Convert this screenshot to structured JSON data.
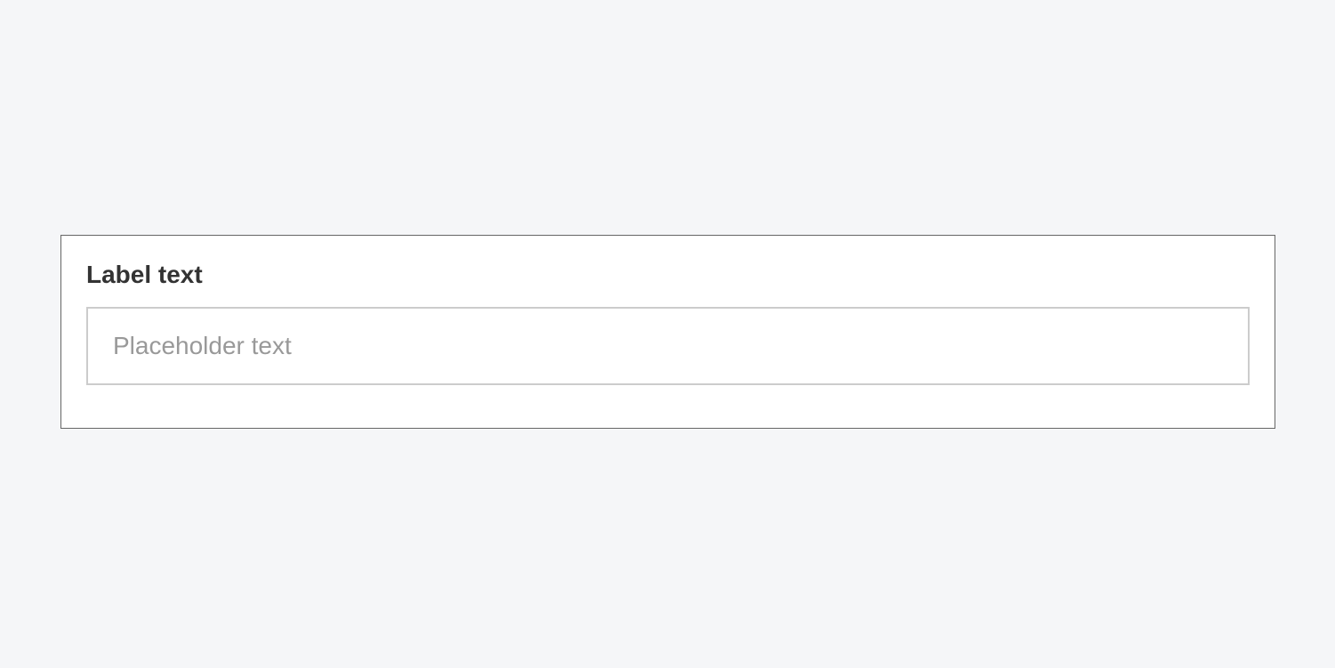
{
  "form": {
    "label": "Label text",
    "input": {
      "placeholder": "Placeholder text",
      "value": ""
    }
  }
}
